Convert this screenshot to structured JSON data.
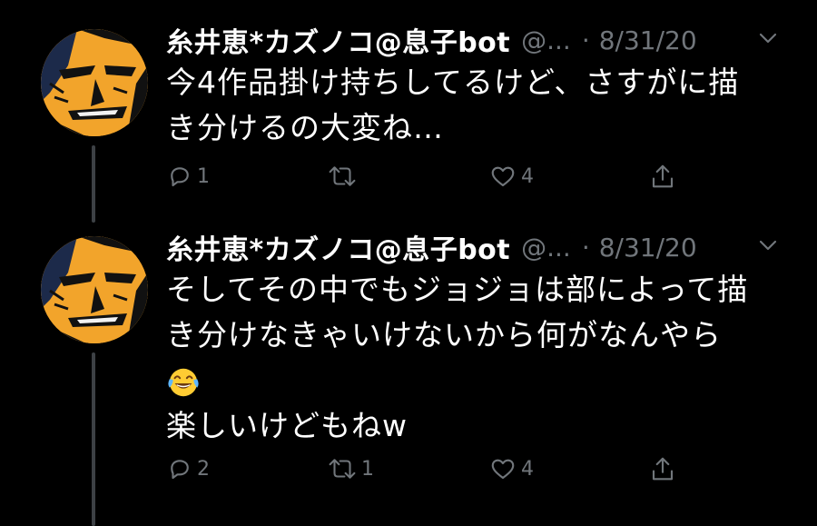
{
  "tweets": [
    {
      "author_name": "糸井恵*カズノコ@息子bot",
      "handle": "@...",
      "separator": "·",
      "date": "8/31/20",
      "lines": [
        "今4作品掛け持ちしてるけど、さすがに描",
        "き分けるの大変ね…"
      ],
      "reply_count": "1",
      "retweet_count": "",
      "like_count": "4"
    },
    {
      "author_name": "糸井恵*カズノコ@息子bot",
      "handle": "@...",
      "separator": "·",
      "date": "8/31/20",
      "lines": [
        "そしてその中でもジョジョは部によって描",
        "き分けなきゃいけないから何がなんやら",
        "",
        "楽しいけどもねw"
      ],
      "emoji": "face-with-tears-of-joy",
      "reply_count": "2",
      "retweet_count": "1",
      "like_count": "4"
    }
  ],
  "colors": {
    "background": "#000000",
    "text": "#ffffff",
    "secondary": "#71767b",
    "thread_line": "#3d4145",
    "avatar_orange": "#f2a42b"
  },
  "icons": [
    "reply-icon",
    "retweet-icon",
    "like-icon",
    "share-icon",
    "chevron-down-icon"
  ]
}
